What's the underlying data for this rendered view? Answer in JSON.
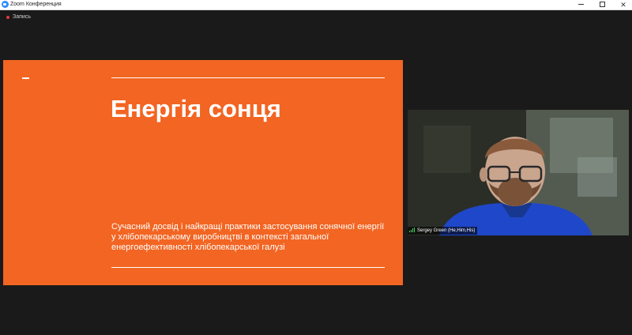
{
  "window": {
    "title": "Zoom Конференция",
    "controls": {
      "minimize": "minimize",
      "restore": "restore",
      "close": "✕"
    }
  },
  "recording": {
    "label": "Запись",
    "color": "#e5383b"
  },
  "slide": {
    "title": "Енергія сонця",
    "subtitle": "Сучасний досвід і найкращі практики застосування сонячної енергії у хлібопекарському виробництві в контексті загальної енергоефективності хлібопекарської галузі",
    "background": "#f26522"
  },
  "participant": {
    "name": "Sergey Green (He,Him,His)",
    "shirt_color": "#1f47c9",
    "signal_icon": "signal-bars-icon"
  }
}
